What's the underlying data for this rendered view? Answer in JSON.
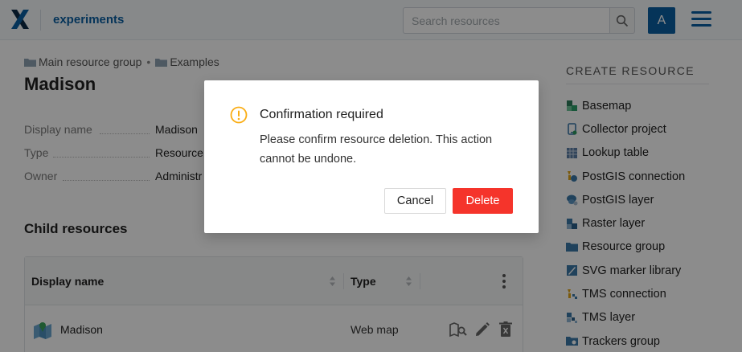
{
  "header": {
    "app_title": "experiments",
    "search_placeholder": "Search resources",
    "avatar_letter": "A"
  },
  "breadcrumb": {
    "items": [
      "Main resource group",
      "Examples"
    ],
    "separator": "•"
  },
  "page": {
    "title": "Madison",
    "info": [
      {
        "label": "Display name",
        "value": "Madison"
      },
      {
        "label": "Type",
        "value": "Resource"
      },
      {
        "label": "Owner",
        "value": "Administr"
      }
    ]
  },
  "child_resources": {
    "title": "Child resources",
    "columns": [
      "Display name",
      "Type"
    ],
    "rows": [
      {
        "name": "Madison",
        "type": "Web map",
        "icon": "web-map-icon"
      }
    ]
  },
  "sidebar": {
    "title": "CREATE RESOURCE",
    "items": [
      {
        "label": "Basemap",
        "icon": "basemap-icon"
      },
      {
        "label": "Collector project",
        "icon": "collector-project-icon"
      },
      {
        "label": "Lookup table",
        "icon": "lookup-table-icon"
      },
      {
        "label": "PostGIS connection",
        "icon": "postgis-connection-icon"
      },
      {
        "label": "PostGIS layer",
        "icon": "postgis-layer-icon"
      },
      {
        "label": "Raster layer",
        "icon": "raster-layer-icon"
      },
      {
        "label": "Resource group",
        "icon": "resource-group-icon"
      },
      {
        "label": "SVG marker library",
        "icon": "svg-marker-library-icon"
      },
      {
        "label": "TMS connection",
        "icon": "tms-connection-icon"
      },
      {
        "label": "TMS layer",
        "icon": "tms-layer-icon"
      },
      {
        "label": "Trackers group",
        "icon": "trackers-group-icon"
      }
    ]
  },
  "dialog": {
    "title": "Confirmation required",
    "message": "Please confirm resource deletion. This action cannot be undone.",
    "cancel_label": "Cancel",
    "delete_label": "Delete",
    "icon": "warning-icon"
  },
  "colors": {
    "brand": "#0a5fa3",
    "danger": "#f5342b",
    "warning": "#faad14"
  }
}
